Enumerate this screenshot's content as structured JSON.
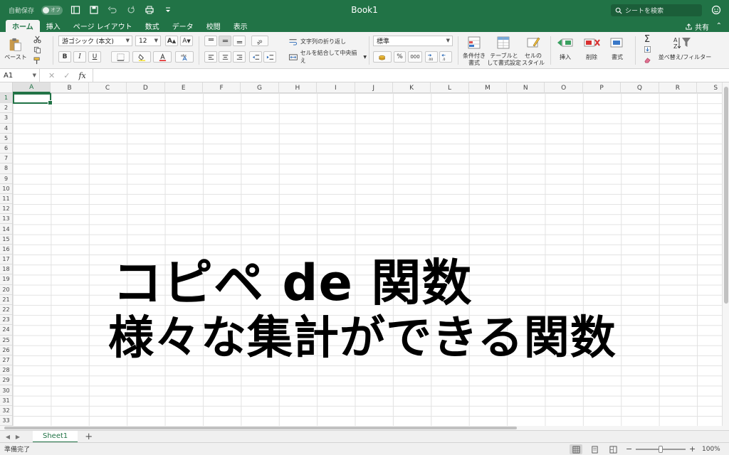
{
  "titlebar": {
    "autosave_label": "自動保存",
    "autosave_state": "オフ",
    "title": "Book1",
    "search_placeholder": "シートを検索"
  },
  "tabs": [
    {
      "label": "ホーム",
      "active": true
    },
    {
      "label": "挿入"
    },
    {
      "label": "ページ レイアウト"
    },
    {
      "label": "数式"
    },
    {
      "label": "データ"
    },
    {
      "label": "校閲"
    },
    {
      "label": "表示"
    }
  ],
  "share_label": "共有",
  "ribbon": {
    "paste_label": "ペースト",
    "font_name": "游ゴシック (本文)",
    "font_size": "12",
    "bold": "B",
    "italic": "I",
    "underline": "U",
    "wrap_text": "文字列の折り返し",
    "merge_center": "セルを結合して中央揃え",
    "number_format": "標準",
    "comma": "000",
    "conditional_format": [
      "条件付き",
      "書式"
    ],
    "format_as_table": [
      "テーブルと",
      "して書式設定"
    ],
    "cell_styles": [
      "セルの",
      "スタイル"
    ],
    "insert": "挿入",
    "delete": "削除",
    "format": "書式",
    "sort_filter": "並べ替え/フィルター"
  },
  "formula_bar": {
    "name_box": "A1",
    "fx": "fx",
    "value": ""
  },
  "grid": {
    "columns": [
      "A",
      "B",
      "C",
      "D",
      "E",
      "F",
      "G",
      "H",
      "I",
      "J",
      "K",
      "L",
      "M",
      "N",
      "O",
      "P",
      "Q",
      "R",
      "S"
    ],
    "rows": [
      "1",
      "2",
      "3",
      "4",
      "5",
      "6",
      "7",
      "8",
      "9",
      "10",
      "11",
      "12",
      "13",
      "14",
      "15",
      "16",
      "17",
      "18",
      "19",
      "20",
      "21",
      "22",
      "23",
      "24",
      "25",
      "26",
      "27",
      "28",
      "29",
      "30",
      "31",
      "32",
      "33"
    ],
    "selected_cell": "A1"
  },
  "overlay": {
    "line1": "コピペ de 関数",
    "line2": "様々な集計ができる関数"
  },
  "sheets": [
    {
      "label": "Sheet1",
      "active": true
    }
  ],
  "add_sheet": "+",
  "status": {
    "text": "準備完了",
    "zoom": "100%",
    "zoom_fraction": 0.5
  },
  "colors": {
    "accent": "#217346"
  }
}
